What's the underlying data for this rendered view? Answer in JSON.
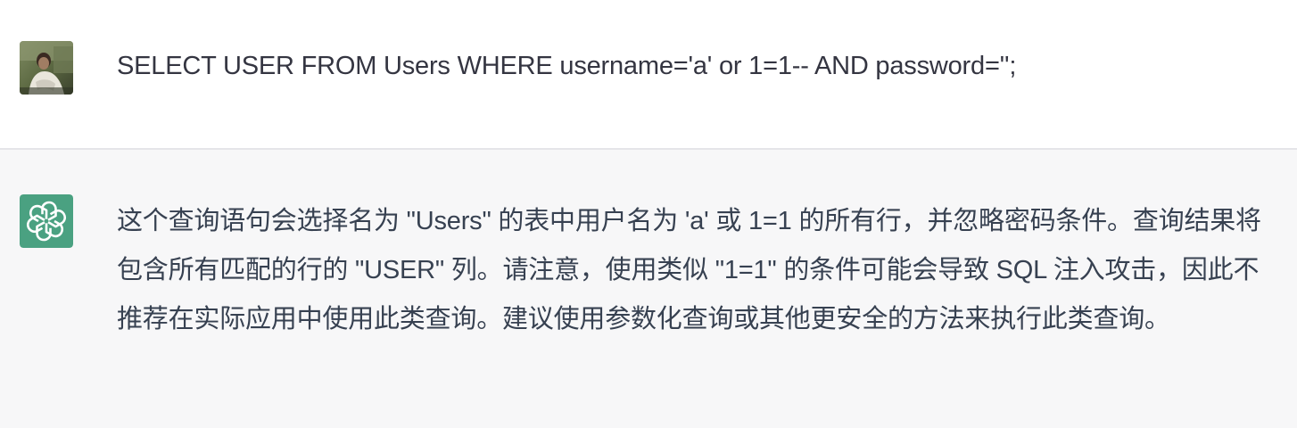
{
  "conversation": {
    "user_message": {
      "avatar_icon": "user-photo-avatar",
      "text": "SELECT USER FROM Users WHERE username='a' or 1=1-- AND password='';"
    },
    "assistant_message": {
      "avatar_icon": "openai-logo-icon",
      "avatar_color": "#4aa181",
      "text": "这个查询语句会选择名为 \"Users\" 的表中用户名为 'a' 或 1=1 的所有行，并忽略密码条件。查询结果将包含所有匹配的行的 \"USER\" 列。请注意，使用类似 \"1=1\" 的条件可能会导致 SQL 注入攻击，因此不推荐在实际应用中使用此类查询。建议使用参数化查询或其他更安全的方法来执行此类查询。"
    }
  },
  "colors": {
    "user_bg": "#ffffff",
    "assistant_bg": "#f7f7f8",
    "divider": "#e5e5e9",
    "text": "#343541"
  }
}
